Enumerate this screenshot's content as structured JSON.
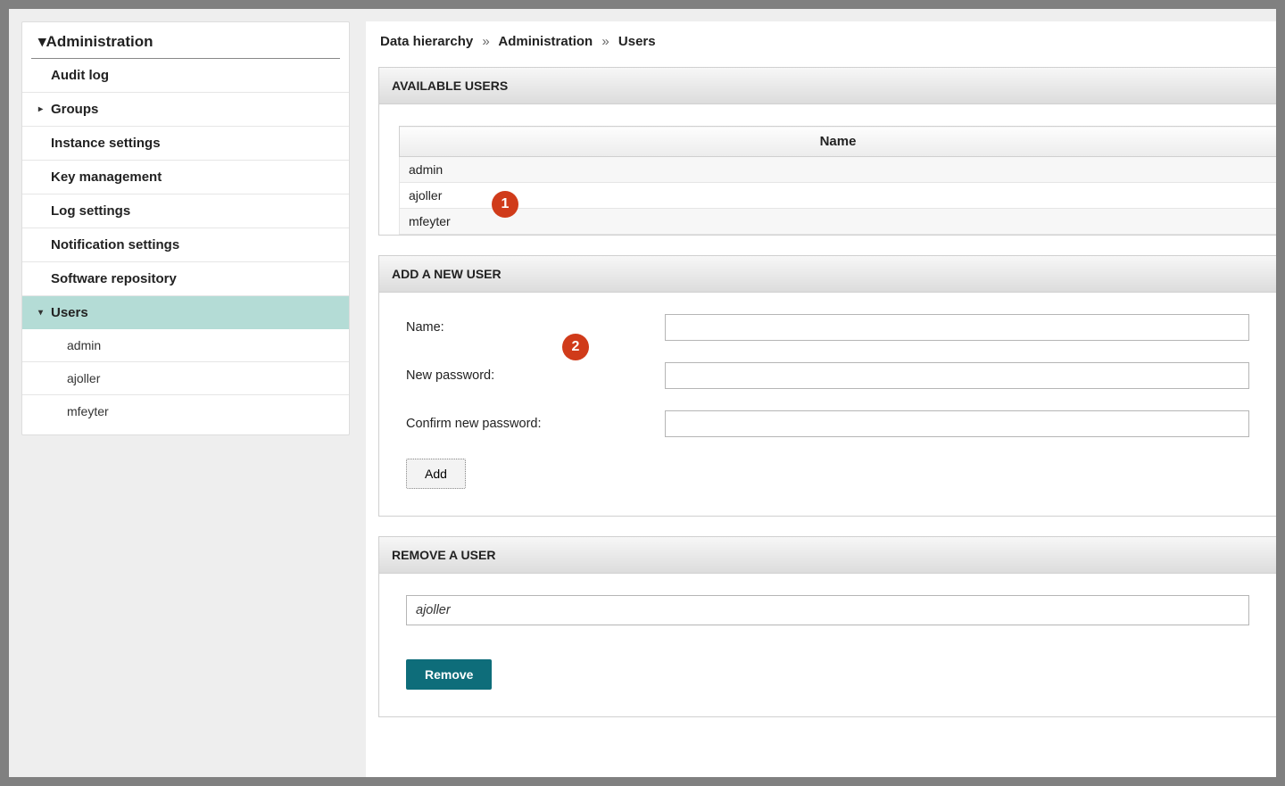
{
  "sidebar": {
    "title": "Administration",
    "items": [
      {
        "label": "Audit log",
        "expandable": false
      },
      {
        "label": "Groups",
        "expandable": true,
        "expanded": false
      },
      {
        "label": "Instance settings",
        "expandable": false
      },
      {
        "label": "Key management",
        "expandable": false
      },
      {
        "label": "Log settings",
        "expandable": false
      },
      {
        "label": "Notification settings",
        "expandable": false
      },
      {
        "label": "Software repository",
        "expandable": false
      },
      {
        "label": "Users",
        "expandable": true,
        "expanded": true,
        "active": true,
        "children": [
          {
            "label": "admin"
          },
          {
            "label": "ajoller"
          },
          {
            "label": "mfeyter"
          }
        ]
      }
    ]
  },
  "breadcrumb": {
    "part1": "Data hierarchy",
    "part2": "Administration",
    "part3": "Users",
    "sep": "»"
  },
  "panels": {
    "available": {
      "title": "AVAILABLE USERS",
      "column": "Name",
      "rows": [
        "admin",
        "ajoller",
        "mfeyter"
      ]
    },
    "add": {
      "title": "ADD A NEW USER",
      "name_label": "Name:",
      "pw_label": "New password:",
      "confirm_label": "Confirm new password:",
      "name_value": "",
      "pw_value": "",
      "confirm_value": "",
      "button": "Add"
    },
    "remove": {
      "title": "REMOVE A USER",
      "selected": "ajoller",
      "button": "Remove"
    }
  },
  "annotations": {
    "step1": "1",
    "step2": "2"
  }
}
